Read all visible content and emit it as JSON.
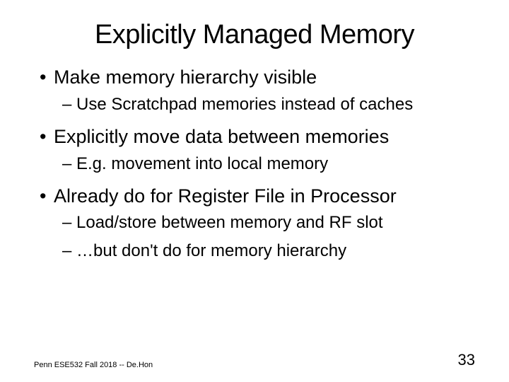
{
  "slide": {
    "title": "Explicitly Managed Memory",
    "groups": [
      {
        "l1": "Make memory hierarchy visible",
        "l2": [
          "Use Scratchpad memories instead of caches"
        ]
      },
      {
        "l1": "Explicitly move data between memories",
        "l2": [
          "E.g. movement into local memory"
        ]
      },
      {
        "l1": "Already do for Register File in Processor",
        "l2": [
          "Load/store between memory and RF slot",
          "…but don't do for memory hierarchy"
        ]
      }
    ],
    "footer_left": "Penn ESE532 Fall 2018 -- De.Hon",
    "page_number": "33"
  }
}
